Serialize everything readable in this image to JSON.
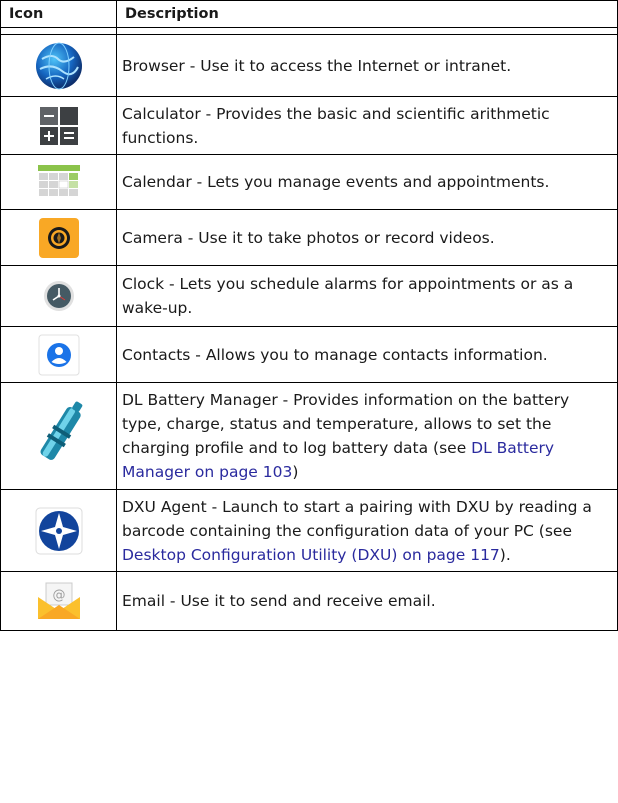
{
  "header": {
    "icon": "Icon",
    "description": "Description"
  },
  "rows": [
    {
      "icon": "browser-globe-icon",
      "text": "Browser - Use it to access the Internet or intranet."
    },
    {
      "icon": "calculator-icon",
      "text": "Calculator - Provides the basic and scientific arithmetic functions."
    },
    {
      "icon": "calendar-icon",
      "text": "Calendar - Lets you manage events and appointments."
    },
    {
      "icon": "camera-icon",
      "text": "Camera - Use it to take photos or record videos."
    },
    {
      "icon": "clock-icon",
      "text": "Clock - Lets you schedule alarms for appointments or as a wake-up."
    },
    {
      "icon": "contacts-icon",
      "text": "Contacts - Allows you to manage contacts information."
    },
    {
      "icon": "battery-icon",
      "text_before": "DL Battery Manager - Provides information on the battery type, charge, status and temperature, allows to set the charging profile and to log battery data (see ",
      "link": "DL Battery Manager on page 103",
      "text_after": ")"
    },
    {
      "icon": "dxu-agent-icon",
      "text_before": "DXU Agent - Launch to start a pairing with DXU by reading a barcode containing the configuration data of your PC (see ",
      "link": "Desktop Configuration Utility (DXU) on page 117",
      "text_after": ")."
    },
    {
      "icon": "email-icon",
      "text": "Email - Use it to send and receive email."
    }
  ]
}
